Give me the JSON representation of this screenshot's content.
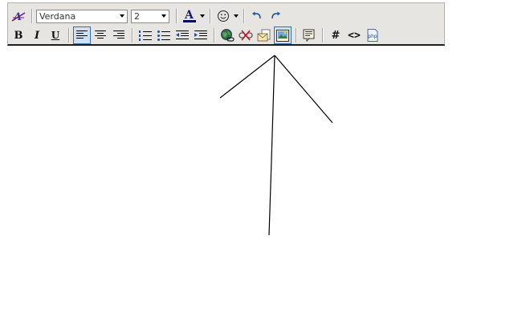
{
  "toolbar": {
    "font_family": {
      "value": "Verdana"
    },
    "font_size": {
      "value": "2"
    },
    "bold_label": "B",
    "italic_label": "I",
    "underline_label": "U",
    "hash_label": "#",
    "code_label": "<>",
    "php_label": "php"
  },
  "colors": {
    "accent": "#3a6ea5",
    "toolbar_bg": "#e7e5e2",
    "font_color_bar": "#000080"
  }
}
